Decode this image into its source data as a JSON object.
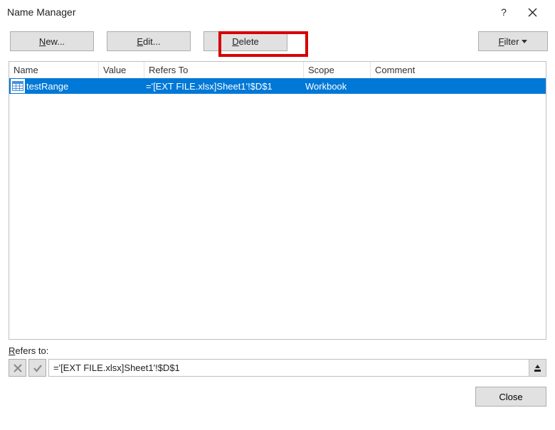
{
  "window": {
    "title": "Name Manager"
  },
  "toolbar": {
    "new_label_pre": "",
    "new_label_u": "N",
    "new_label_post": "ew...",
    "edit_label_pre": "",
    "edit_label_u": "E",
    "edit_label_post": "dit...",
    "delete_label_pre": "",
    "delete_label_u": "D",
    "delete_label_post": "elete",
    "filter_label_pre": "",
    "filter_label_u": "F",
    "filter_label_post": "ilter"
  },
  "columns": {
    "name": "Name",
    "value": "Value",
    "refers": "Refers To",
    "scope": "Scope",
    "comment": "Comment"
  },
  "rows": [
    {
      "name": "testRange",
      "value": "",
      "refers_to": "='[EXT FILE.xlsx]Sheet1'!$D$1",
      "scope": "Workbook",
      "comment": ""
    }
  ],
  "refers_section": {
    "label_u": "R",
    "label_post": "efers to:",
    "value": "='[EXT FILE.xlsx]Sheet1'!$D$1"
  },
  "footer": {
    "close_label": "Close"
  }
}
